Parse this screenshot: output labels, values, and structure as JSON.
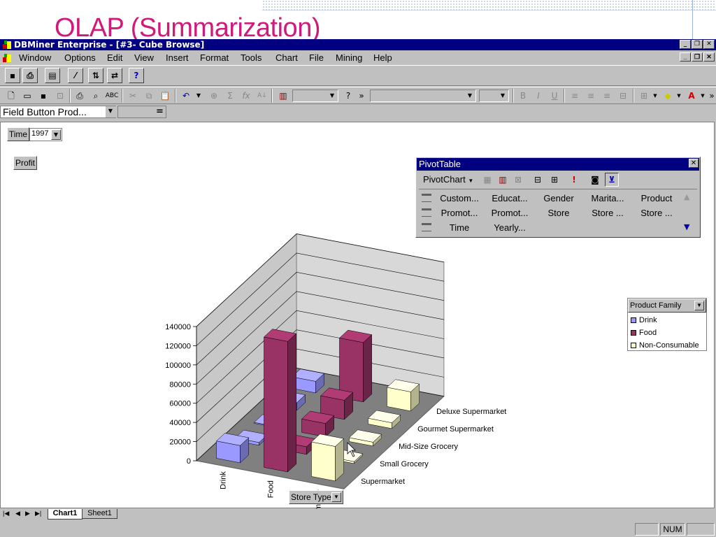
{
  "slide": {
    "title": "OLAP (Summarization)"
  },
  "window": {
    "title": "DBMiner Enterprise - [#3- Cube Browse]",
    "menus": [
      "Window",
      "Options",
      "Edit",
      "View",
      "Insert",
      "Format",
      "Tools",
      "Chart",
      "File",
      "Mining",
      "Help"
    ]
  },
  "formula_bar": {
    "name_box": "Field Button Prod...",
    "equals": "="
  },
  "page_field": {
    "label": "Time",
    "value": "1997"
  },
  "data_field": {
    "label": "Profit"
  },
  "pivot_table": {
    "title": "PivotTable",
    "menu_label": "PivotChart",
    "fields": [
      [
        "Custom...",
        "Educat...",
        "Gender",
        "Marita...",
        "Product"
      ],
      [
        "Promot...",
        "Promot...",
        "Store",
        "Store ...",
        "Store ..."
      ],
      [
        "Time",
        "Yearly..."
      ]
    ]
  },
  "legend": {
    "title": "Product Family",
    "items": [
      {
        "name": "Drink",
        "color": "#9999ff"
      },
      {
        "name": "Food",
        "color": "#993366"
      },
      {
        "name": "Non-Consumable",
        "color": "#ffffcc"
      }
    ]
  },
  "category_button": {
    "label": "Store Type"
  },
  "sheet_tabs": [
    "Chart1",
    "Sheet1"
  ],
  "status": {
    "num": "NUM"
  },
  "chart_data": {
    "type": "bar",
    "subtype": "3d-column",
    "categories": [
      "Supermarket",
      "Small Grocery",
      "Mid-Size Grocery",
      "Gourmet Supermarket",
      "Deluxe Supermarket"
    ],
    "series": [
      {
        "name": "Drink",
        "color": "#9999ff",
        "values": [
          18000,
          3000,
          1000,
          8000,
          12000
        ]
      },
      {
        "name": "Food",
        "color": "#993366",
        "values": [
          136000,
          8000,
          14000,
          20000,
          62000
        ]
      },
      {
        "name": "Non-Consumable",
        "color": "#ffffcc",
        "values": [
          36000,
          2000,
          4000,
          6000,
          20000
        ]
      }
    ],
    "y_ticks": [
      "0",
      "20000",
      "40000",
      "60000",
      "80000",
      "100000",
      "120000",
      "140000"
    ],
    "ylim": [
      0,
      140000
    ],
    "grid": true,
    "legend_position": "right"
  }
}
